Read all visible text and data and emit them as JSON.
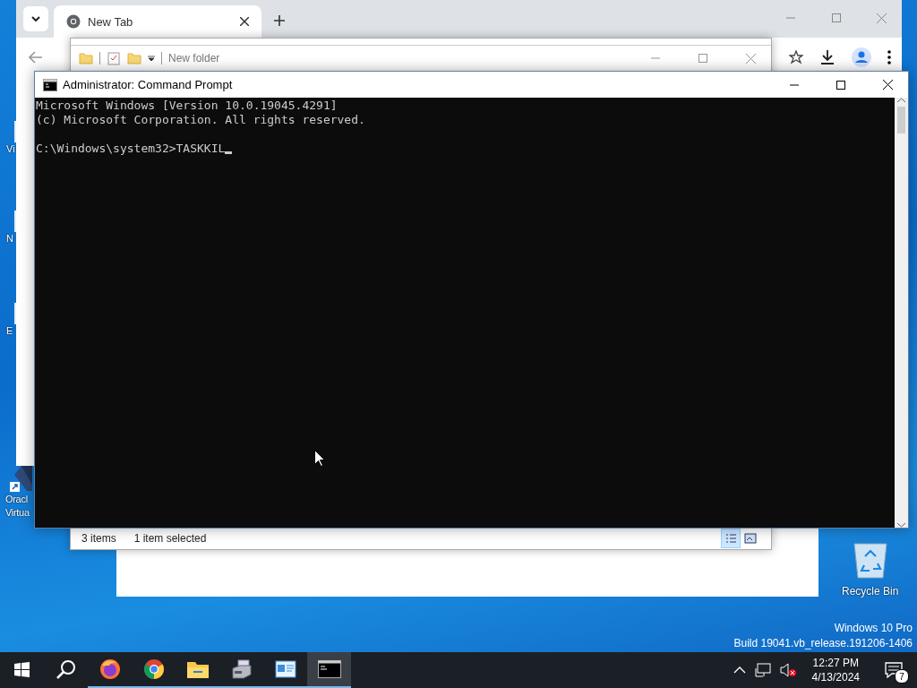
{
  "desktop_icons": [
    {
      "lines": [
        "Vi"
      ],
      "kind": "partial"
    },
    {
      "lines": [
        "N"
      ],
      "kind": "partial"
    },
    {
      "lines": [
        "E"
      ],
      "kind": "partial"
    },
    {
      "lines": [
        "Oracl",
        "Virtua"
      ],
      "kind": "full"
    }
  ],
  "browser": {
    "tabs": [
      {
        "title": "New Tab",
        "selected": true
      }
    ]
  },
  "explorer": {
    "title": "New folder",
    "status_count": "3 items",
    "status_selection": "1 item selected",
    "views": [
      {
        "kind": "details",
        "selected": true
      },
      {
        "kind": "thumbnails",
        "selected": false
      }
    ]
  },
  "console": {
    "title": "Administrator: Command Prompt",
    "banner": [
      "Microsoft Windows [Version 10.0.19045.4291]",
      "(c) Microsoft Corporation. All rights reserved."
    ],
    "prompt_line": "C:\\Windows\\system32>TASKKIL"
  },
  "recycle_bin": {
    "label": "Recycle Bin"
  },
  "os_info": [
    "Windows 10 Pro",
    "Build 19041.vb_release.191206-1406"
  ],
  "taskbar": {
    "apps": [
      {
        "kind": "start",
        "running": false,
        "selected": false
      },
      {
        "kind": "search",
        "running": false,
        "selected": false
      },
      {
        "kind": "firefox",
        "running": true,
        "selected": false
      },
      {
        "kind": "chrome",
        "running": true,
        "selected": false
      },
      {
        "kind": "files",
        "running": true,
        "selected": false
      },
      {
        "kind": "server",
        "running": true,
        "selected": false
      },
      {
        "kind": "panel",
        "running": true,
        "selected": false
      },
      {
        "kind": "console",
        "running": true,
        "selected": true
      }
    ],
    "time": "12:27 PM",
    "date": "4/13/2024",
    "notifications": "7"
  }
}
